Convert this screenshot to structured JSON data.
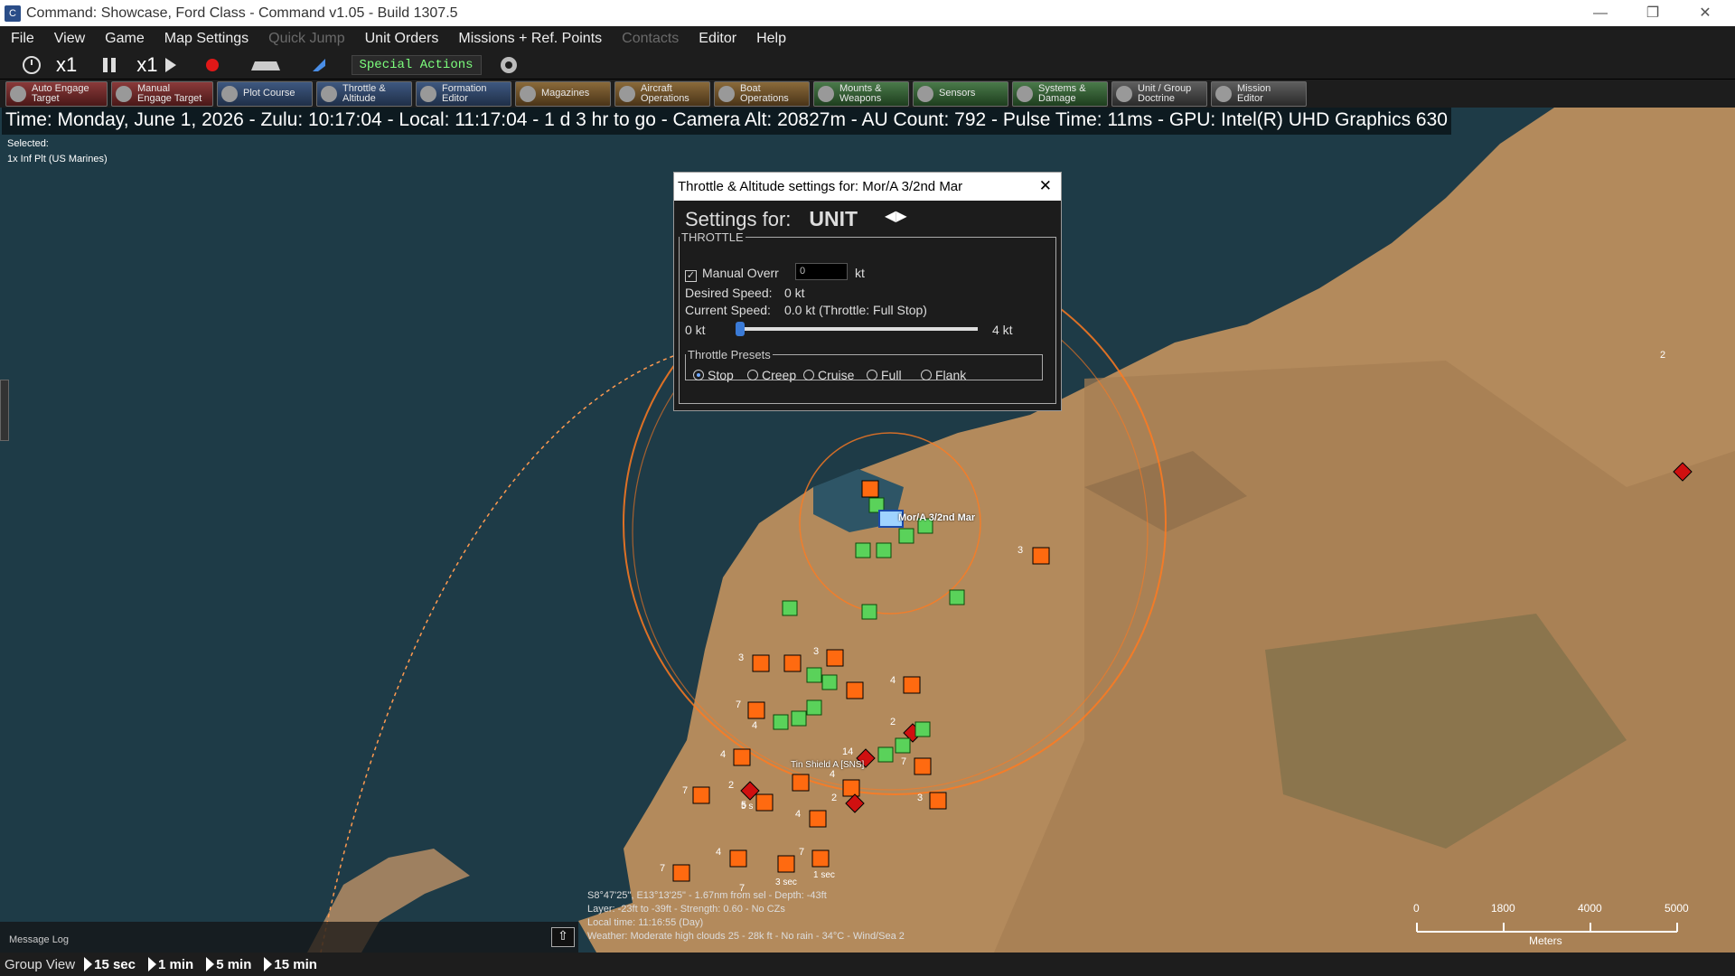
{
  "window": {
    "title": "Command: Showcase, Ford Class - Command v1.05 - Build 1307.5"
  },
  "menu": [
    "File",
    "View",
    "Game",
    "Map Settings",
    "Quick Jump",
    "Unit Orders",
    "Missions + Ref. Points",
    "Contacts",
    "Editor",
    "Help"
  ],
  "time_controls": {
    "compression_label": "x1",
    "speed_label": "x1",
    "special_actions": "Special Actions"
  },
  "toolbar": [
    {
      "l1": "Auto Engage",
      "l2": "Target",
      "style": "red"
    },
    {
      "l1": "Manual",
      "l2": "Engage Target",
      "style": "red"
    },
    {
      "l1": "Plot Course",
      "l2": "",
      "style": "blue"
    },
    {
      "l1": "Throttle &",
      "l2": "Altitude",
      "style": "blue"
    },
    {
      "l1": "Formation",
      "l2": "Editor",
      "style": "blue"
    },
    {
      "l1": "Magazines",
      "l2": "",
      "style": "orange"
    },
    {
      "l1": "Aircraft",
      "l2": "Operations",
      "style": "orange"
    },
    {
      "l1": "Boat",
      "l2": "Operations",
      "style": "orange"
    },
    {
      "l1": "Mounts &",
      "l2": "Weapons",
      "style": "green"
    },
    {
      "l1": "Sensors",
      "l2": "",
      "style": "green"
    },
    {
      "l1": "Systems &",
      "l2": "Damage",
      "style": "green"
    },
    {
      "l1": "Unit / Group",
      "l2": "Doctrine",
      "style": "grey"
    },
    {
      "l1": "Mission",
      "l2": "Editor",
      "style": "grey"
    }
  ],
  "status_line": "Time: Monday, June 1, 2026 - Zulu: 10:17:04 - Local: 11:17:04 - 1 d 3 hr to go -  Camera Alt: 20827m  - AU Count: 792 - Pulse Time: 11ms - GPU: Intel(R) UHD Graphics 630",
  "selected": {
    "label": "Selected:",
    "unit": "1x Inf Plt (US Marines)"
  },
  "dialog": {
    "title": "Throttle & Altitude settings for: Mor/A 3/2nd Mar",
    "settings_for_label": "Settings for:",
    "settings_for_value": "UNIT",
    "throttle_legend": "THROTTLE",
    "manual_override_label": "Manual Overr",
    "manual_override_checked": true,
    "manual_override_value": "0",
    "manual_override_unit": "kt",
    "desired_speed_label": "Desired Speed:",
    "desired_speed_value": "0 kt",
    "current_speed_label": "Current Speed:",
    "current_speed_value": "0.0 kt (Throttle: Full Stop)",
    "slider_min_label": "0 kt",
    "slider_max_label": "4 kt",
    "slider_fraction": 0.0,
    "presets_legend": "Throttle Presets",
    "presets": [
      "Stop",
      "Creep",
      "Cruise",
      "Full",
      "Flank"
    ],
    "selected_preset": "Stop"
  },
  "map": {
    "unit_labels": [
      "Mor/A 3/2nd Mar",
      "Tin Shield A [SNS]"
    ],
    "counts": [
      "2",
      "3",
      "3",
      "3",
      "4",
      "7",
      "4",
      "4",
      "7",
      "2",
      "5",
      "4",
      "2",
      "14",
      "7",
      "2",
      "3",
      "4",
      "7",
      "7",
      "4",
      "7"
    ],
    "time_tags": [
      "3 sec",
      "1 sec",
      "5 s"
    ],
    "cursor_info": [
      "S8°47'25\", E13°13'25\" - 1.67nm from sel - Depth: -43ft",
      "Layer: -23ft to -39ft - Strength: 0.60 - No CZs",
      "Local time: 11:16:55 (Day)",
      "Weather: Moderate high clouds 25 - 28k ft - No rain - 34°C - Wind/Sea 2"
    ],
    "message_log_label": "Message Log",
    "scale": {
      "ticks": [
        "0",
        "1800",
        "4000",
        "5000"
      ],
      "unit": "Meters"
    }
  },
  "bottombar": {
    "group_view": "Group View",
    "time_jumps": [
      "15 sec",
      "1 min",
      "5 min",
      "15 min"
    ]
  }
}
